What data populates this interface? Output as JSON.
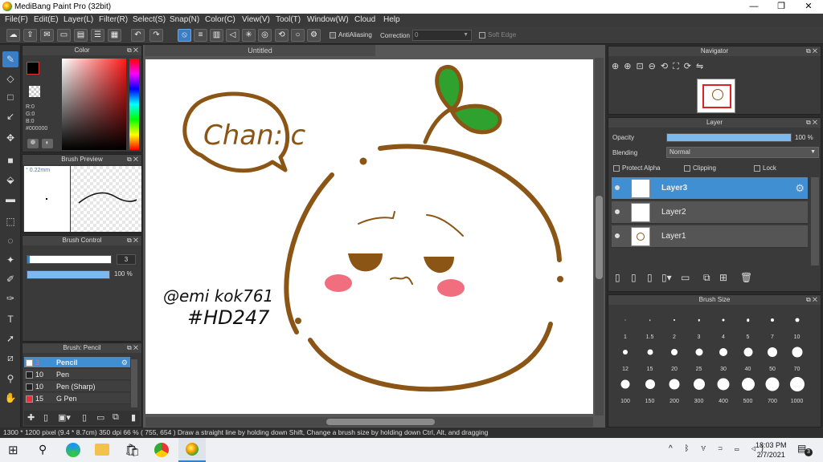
{
  "window": {
    "title": "MediBang Paint Pro (32bit)",
    "minimize": "—",
    "maximize": "❐",
    "close": "✕"
  },
  "menu": [
    "File(F)",
    "Edit(E)",
    "Layer(L)",
    "Filter(R)",
    "Select(S)",
    "Snap(N)",
    "Color(C)",
    "View(V)",
    "Tool(T)",
    "Window(W)",
    "Cloud",
    "Help"
  ],
  "toolbar": {
    "antialiasing_label": "AntiAliasing",
    "correction_label": "Correction",
    "correction_value": "0",
    "soft_edge_label": "Soft Edge"
  },
  "color_panel": {
    "title": "Color",
    "r": "R:0",
    "g": "G:0",
    "b": "B:0",
    "hex": "#000000",
    "main_color": "#000000"
  },
  "brush_preview": {
    "title": "Brush Preview",
    "size": "0.22mm"
  },
  "brush_control": {
    "title": "Brush Control",
    "size_value": "3",
    "opacity_value": "100 %"
  },
  "brush_list": {
    "title": "Brush: Pencil",
    "items": [
      {
        "size": "3",
        "name": "Pencil",
        "color": "#ffffff",
        "selected": true
      },
      {
        "size": "10",
        "name": "Pen",
        "color": "#222222",
        "selected": false
      },
      {
        "size": "10",
        "name": "Pen (Sharp)",
        "color": "#222222",
        "selected": false
      },
      {
        "size": "15",
        "name": "G Pen",
        "color": "#e53333",
        "selected": false
      }
    ]
  },
  "canvas": {
    "tab": "Untitled",
    "bubble_text": "Chan:'c",
    "signature_line1": "@emi kok761",
    "signature_line2": "#HD247"
  },
  "navigator": {
    "title": "Navigator"
  },
  "layer_panel": {
    "title": "Layer",
    "opacity_label": "Opacity",
    "opacity_value": "100 %",
    "opacity_level": 1.0,
    "blending_label": "Blending",
    "blending_value": "Normal",
    "protect_alpha": "Protect Alpha",
    "clipping": "Clipping",
    "lock": "Lock",
    "layers": [
      {
        "name": "Layer3",
        "selected": true
      },
      {
        "name": "Layer2",
        "selected": false
      },
      {
        "name": "Layer1",
        "selected": false
      }
    ]
  },
  "brush_size": {
    "title": "Brush Size",
    "sizes": [
      "1",
      "1.5",
      "2",
      "3",
      "4",
      "5",
      "7",
      "10",
      "12",
      "15",
      "20",
      "25",
      "30",
      "40",
      "50",
      "70",
      "100",
      "150",
      "200",
      "300",
      "400",
      "500",
      "700",
      "1000"
    ]
  },
  "status": {
    "text": "1300 * 1200 pixel   (9.4 * 8.7cm)   350 dpi   66 %   ( 755, 654 )   Draw a straight line by holding down Shift, Change a brush size by holding down Ctrl, Alt, and dragging"
  },
  "taskbar": {
    "time": "18:03 PM",
    "date": "2/7/2021",
    "notification_count": "3"
  },
  "colors": {
    "brown": "#8b5516",
    "leaf_green": "#2fa12f",
    "blush": "#f06e7e",
    "accent": "#3a7fc4"
  }
}
